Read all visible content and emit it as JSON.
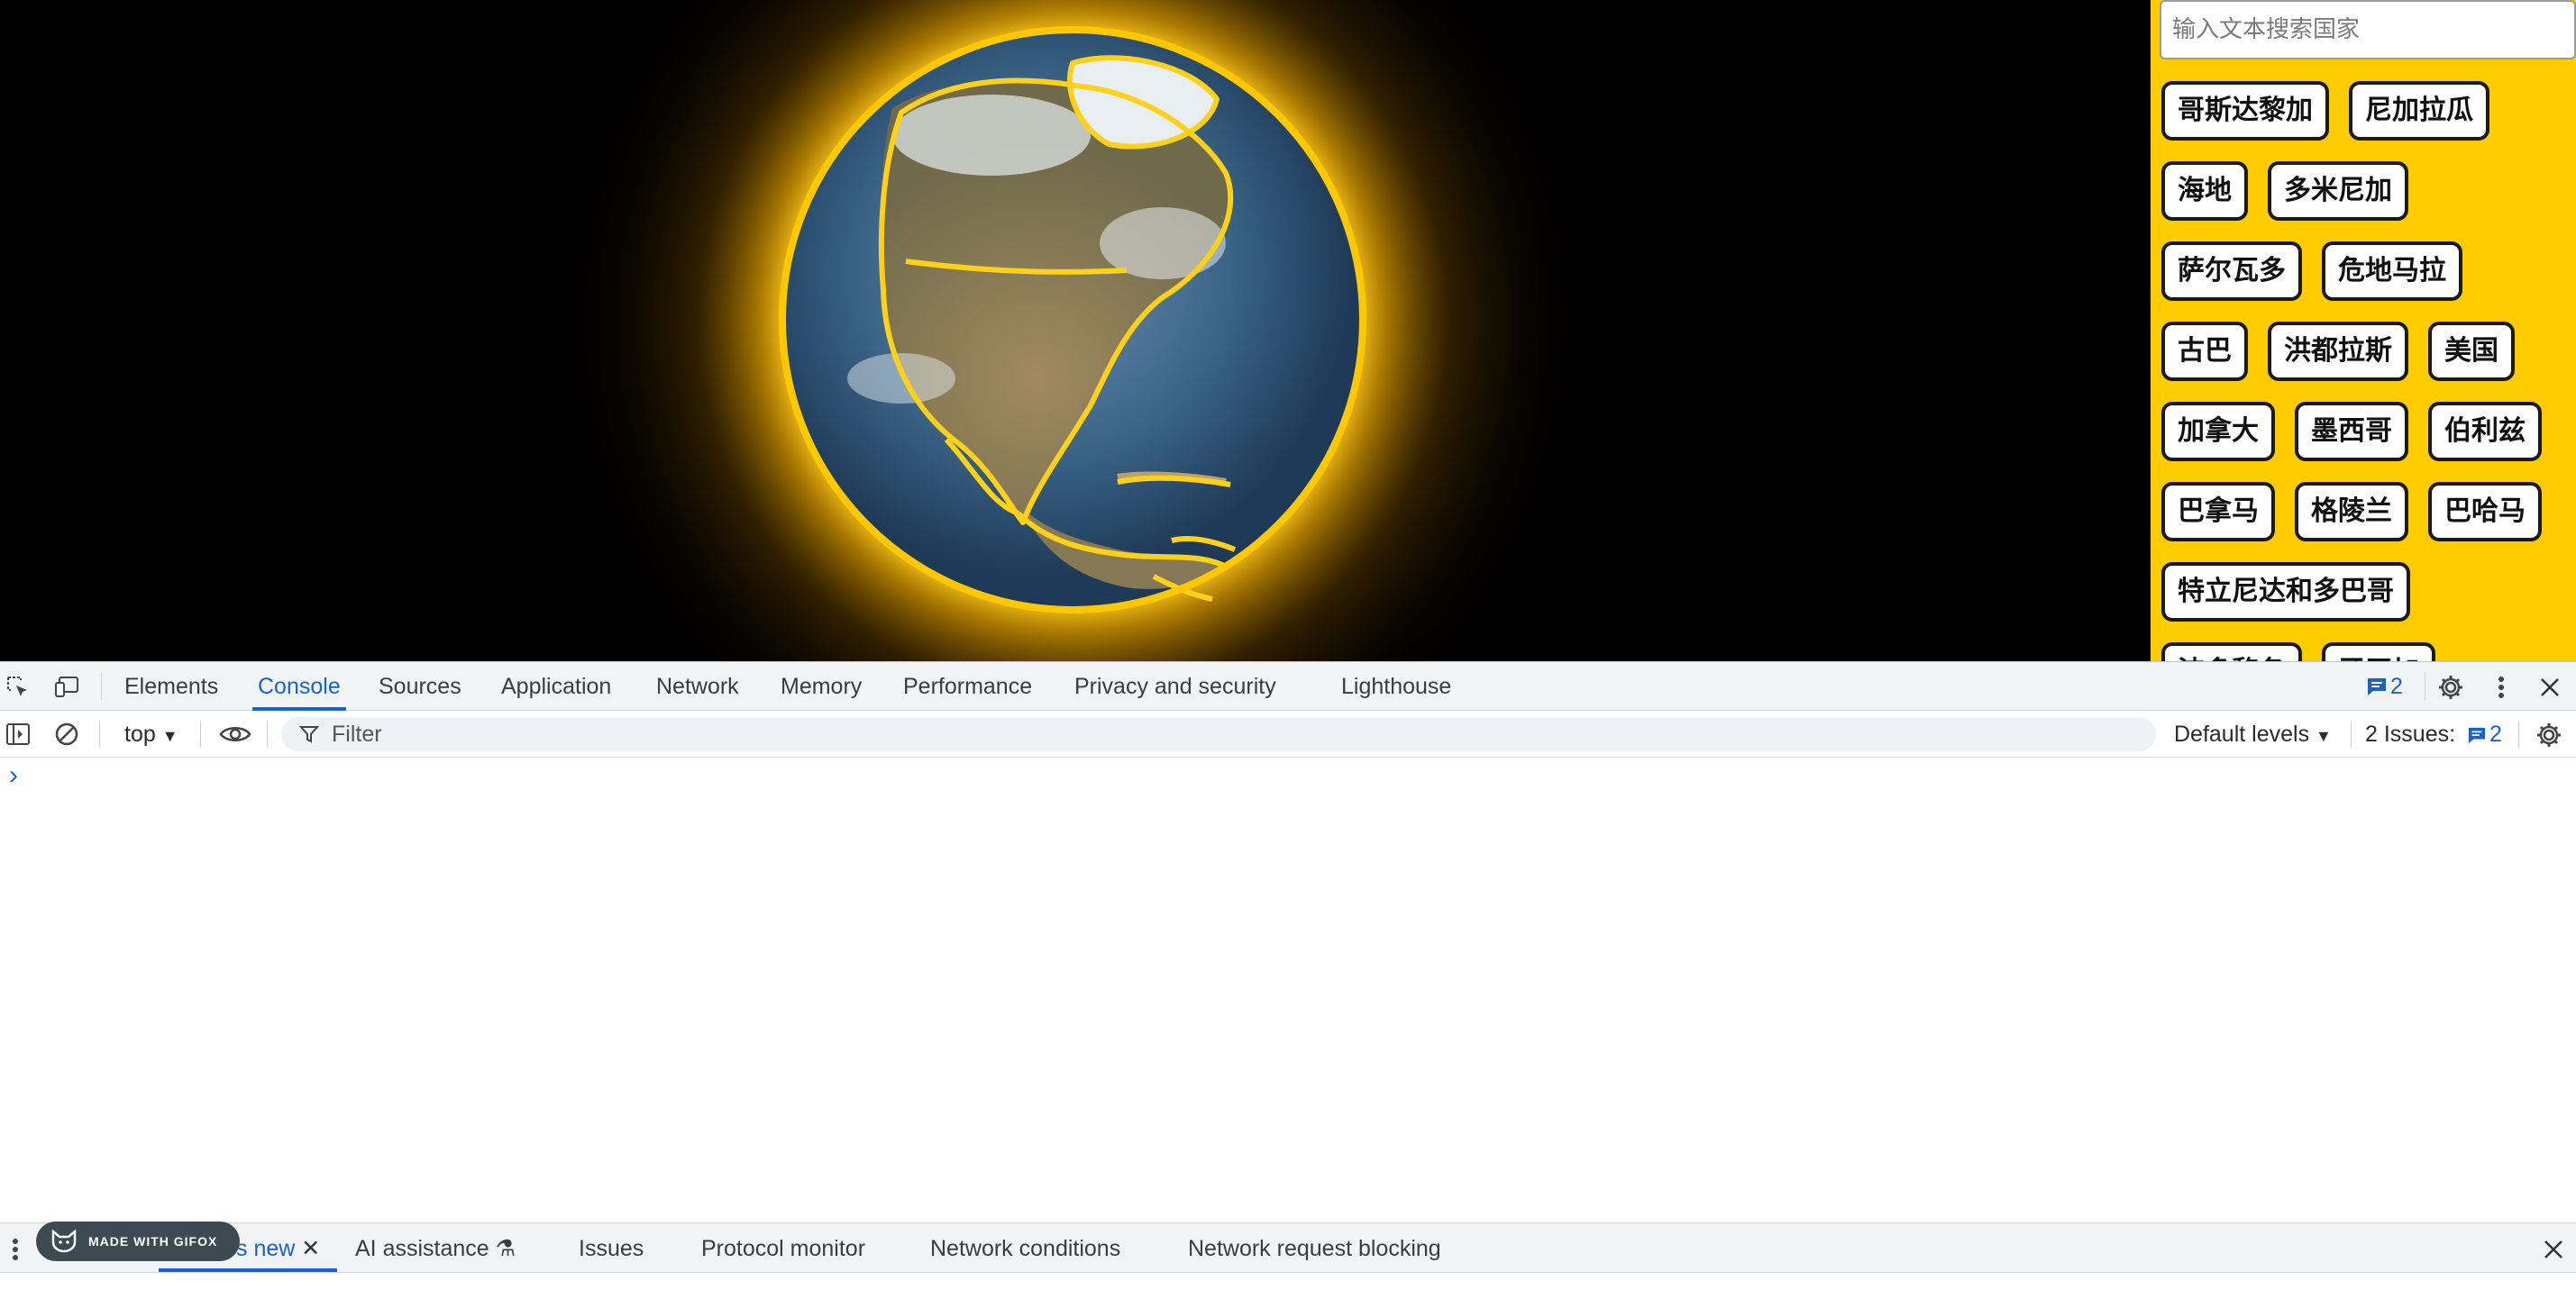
{
  "search": {
    "placeholder": "输入文本搜索国家"
  },
  "countries": [
    "哥斯达黎加",
    "尼加拉瓜",
    "海地",
    "多米尼加",
    "萨尔瓦多",
    "危地马拉",
    "古巴",
    "洪都拉斯",
    "美国",
    "加拿大",
    "墨西哥",
    "伯利兹",
    "巴拿马",
    "格陵兰",
    "巴哈马",
    "特立尼达和多巴哥",
    "波多黎各",
    "牙买加"
  ],
  "devtools": {
    "tabs": [
      "Elements",
      "Console",
      "Sources",
      "Application",
      "Network",
      "Memory",
      "Performance",
      "Privacy and security",
      "Lighthouse"
    ],
    "active_tab": "Console",
    "message_count": "2",
    "toolbar": {
      "context": "top",
      "filter_placeholder": "Filter",
      "levels": "Default levels",
      "issues_label": "2 Issues:",
      "issues_count": "2"
    },
    "prompt": "›",
    "drawer_tabs": [
      "What's new",
      "AI assistance",
      "Issues",
      "Protocol monitor",
      "Network conditions",
      "Network request blocking"
    ],
    "drawer_partial_tab": "s new"
  },
  "gifox_badge": "MADE WITH GIFOX",
  "colors": {
    "panel_bg": "#ffcc00",
    "globe_outline": "#ffd11a",
    "ocean": "#2f5676",
    "active_tab": "#1a62c8",
    "devtools_bar": "#f1f3f4"
  }
}
